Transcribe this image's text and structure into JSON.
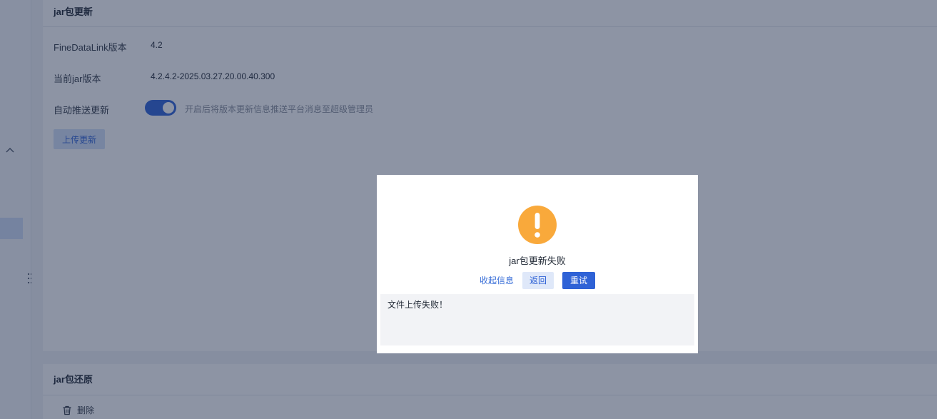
{
  "update_card": {
    "title": "jar包更新",
    "version_label": "FineDataLink版本",
    "version_value": "4.2",
    "current_jar_label": "当前jar版本",
    "current_jar_value": "4.2.4.2-2025.03.27.20.00.40.300",
    "auto_push_label": "自动推送更新",
    "auto_push_enabled": true,
    "auto_push_hint": "开启后将版本更新信息推送平台消息至超级管理员",
    "upload_button": "上传更新"
  },
  "restore_card": {
    "title": "jar包还原",
    "delete_label": "删除"
  },
  "dialog": {
    "icon": "warning-icon",
    "title": "jar包更新失败",
    "collapse_label": "收起信息",
    "back_label": "返回",
    "retry_label": "重试",
    "detail_text": "文件上传失败！"
  },
  "colors": {
    "primary": "#2f62d6",
    "warning": "#f9a93b",
    "overlay": "rgba(27,42,74,0.5)"
  }
}
